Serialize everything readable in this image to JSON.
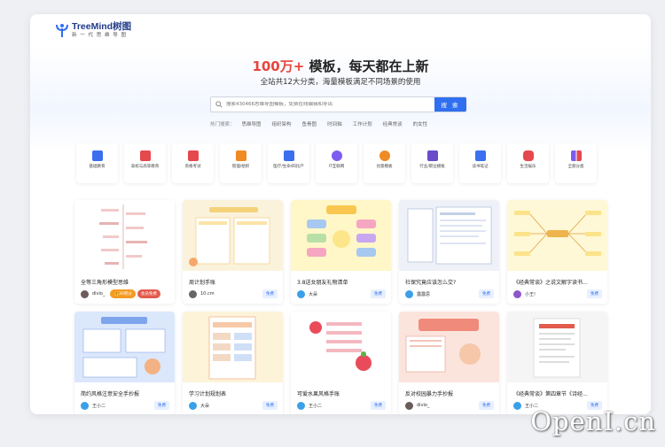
{
  "brand": {
    "name": "TreeMind树图",
    "tagline": "新 一 代 思 维 导 图"
  },
  "hero": {
    "title_red": "100万+",
    "title_rest": " 模板，每天都在上新",
    "subtitle": "全站共12大分类，海量模板满足不同场景的使用"
  },
  "search": {
    "placeholder": "搜索430466思维导图模板，免费在线编辑和导出",
    "button": "搜 索"
  },
  "hot": {
    "label": "热门搜索：",
    "items": [
      "思维导图",
      "组织架构",
      "鱼骨图",
      "时间轴",
      "工作计划",
      "经典常谈",
      "的女性"
    ]
  },
  "categories": [
    {
      "label": "基础教育",
      "color": "#3b6ff0"
    },
    {
      "label": "高校与高等教育",
      "color": "#e5484d"
    },
    {
      "label": "资格考试",
      "color": "#e5484d"
    },
    {
      "label": "管理/组织",
      "color": "#f08a24"
    },
    {
      "label": "医疗/生命/四比产",
      "color": "#3b6ff0"
    },
    {
      "label": "IT互联网",
      "color": "#7c5cf0"
    },
    {
      "label": "创意模板",
      "color": "#f08a24"
    },
    {
      "label": "行业/职业模板",
      "color": "#6a4cc9"
    },
    {
      "label": "读书笔记",
      "color": "#3b6ff0"
    },
    {
      "label": "生活娱乐",
      "color": "#e5484d"
    },
    {
      "label": "全部分类",
      "color": "#7c5cf0"
    }
  ],
  "cards": [
    {
      "title": "全等三角形模型思维",
      "author": "divio_",
      "badge": "",
      "vip": "💰30积分",
      "vip2": "会员免费",
      "thumb": "#ffffff",
      "avatar": "#6b5b5b"
    },
    {
      "title": "周计划手账",
      "author": "10.cm",
      "badge": "免费",
      "vip": "",
      "vip2": "",
      "thumb": "#fbf2dc",
      "avatar": "#666"
    },
    {
      "title": "3.8送女朋友礼物清单",
      "author": "大朵",
      "badge": "免费",
      "vip": "",
      "vip2": "",
      "thumb": "#fff7c8",
      "avatar": "#3aa0e8"
    },
    {
      "title": "社保究竟应该怎么交?",
      "author": "露露思",
      "badge": "免费",
      "vip": "",
      "vip2": "",
      "thumb": "#eef1f7",
      "avatar": "#3aa0e8"
    },
    {
      "title": "《经典常谈》之说文解字读书...",
      "author": "小王!",
      "badge": "免费",
      "vip": "",
      "vip2": "",
      "thumb": "#fff8d6",
      "avatar": "#8d56c9"
    },
    {
      "title": "简约风格注意安全手抄报",
      "author": "王小二",
      "badge": "免费",
      "vip": "",
      "vip2": "",
      "thumb": "#dbe7fb",
      "avatar": "#3aa0e8"
    },
    {
      "title": "学习计划规划表",
      "author": "大朵",
      "badge": "免费",
      "vip": "",
      "vip2": "",
      "thumb": "#fdf3d9",
      "avatar": "#3aa0e8"
    },
    {
      "title": "可爱水果风格手账",
      "author": "王小二",
      "badge": "免费",
      "vip": "",
      "vip2": "",
      "thumb": "#ffffff",
      "avatar": "#3aa0e8"
    },
    {
      "title": "反对校园暴力手抄报",
      "author": "divio_",
      "badge": "免费",
      "vip": "",
      "vip2": "",
      "thumb": "#fbe4dc",
      "avatar": "#6b5b5b"
    },
    {
      "title": "《经典常谈》第四章节《诗经...",
      "author": "王小二",
      "badge": "免费",
      "vip": "",
      "vip2": "",
      "thumb": "#f5f5f5",
      "avatar": "#3aa0e8"
    }
  ],
  "watermark": "OpenI.cn"
}
